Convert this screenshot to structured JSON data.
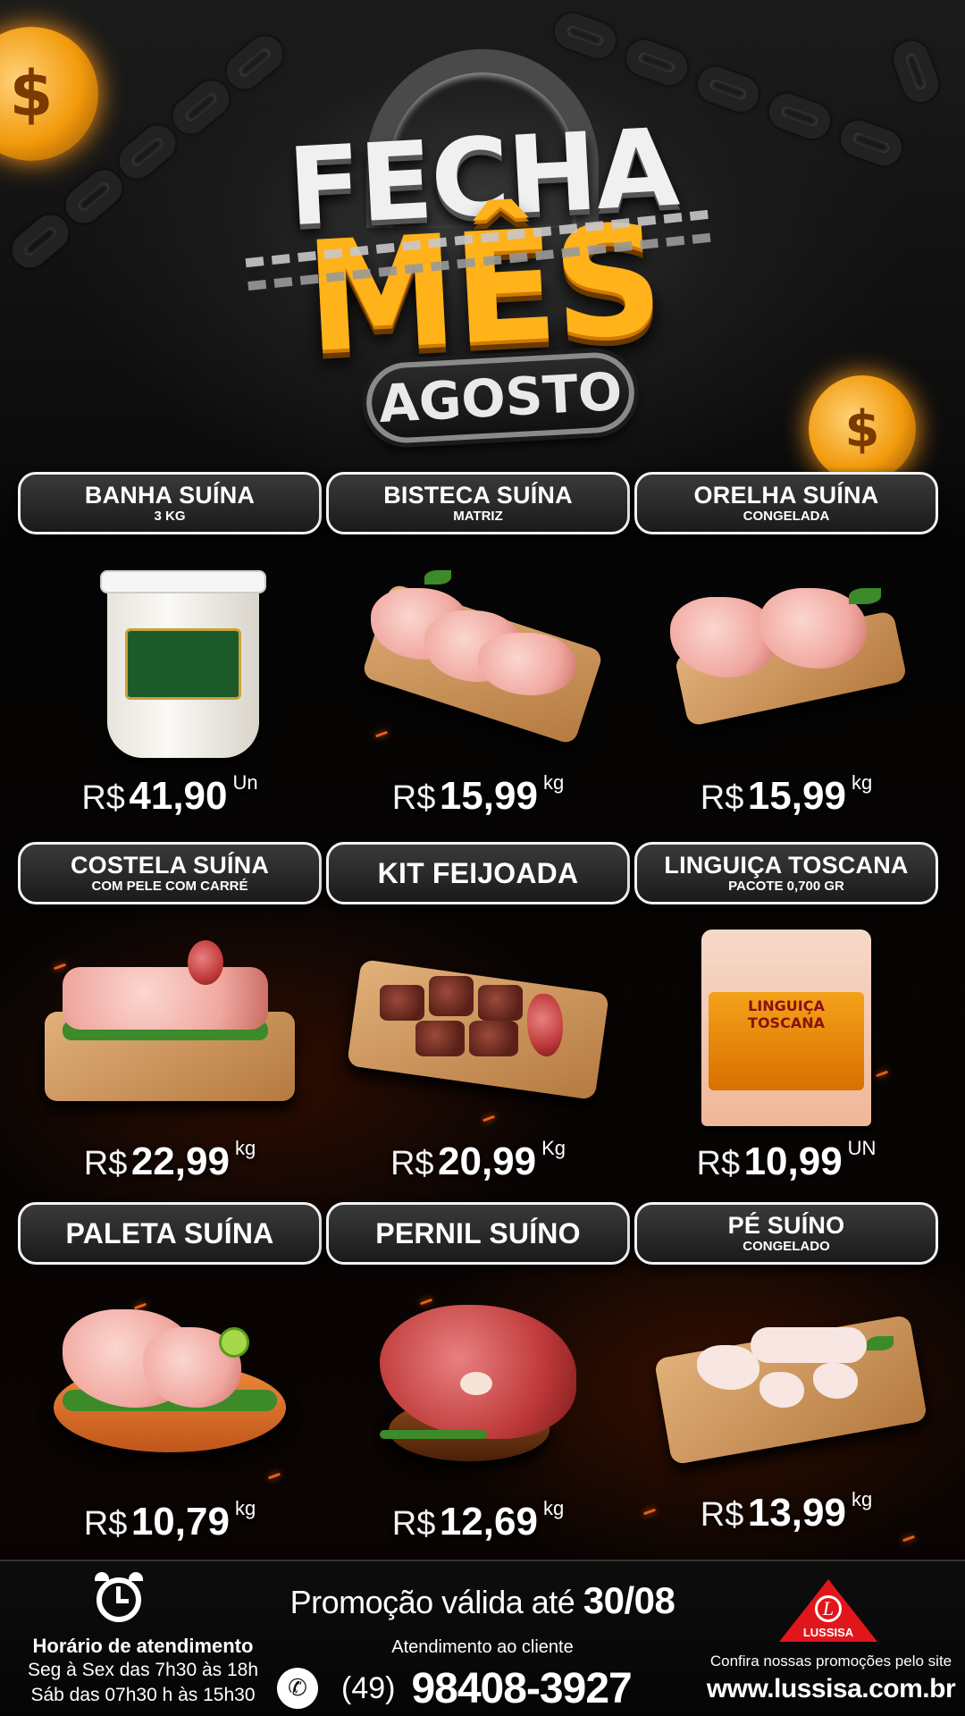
{
  "header": {
    "title_top": "FECHA",
    "title_main": "MÊS",
    "month": "AGOSTO",
    "coin_symbol": "$"
  },
  "products": [
    {
      "name": "BANHA SUÍNA",
      "subtitle": "3 KG",
      "currency": "R$",
      "price": "41,90",
      "unit": "Un",
      "icon": "lard-bucket-icon"
    },
    {
      "name": "BISTECA SUÍNA",
      "subtitle": "MATRIZ",
      "currency": "R$",
      "price": "15,99",
      "unit": "kg",
      "icon": "pork-chop-icon"
    },
    {
      "name": "ORELHA SUÍNA",
      "subtitle": "CONGELADA",
      "currency": "R$",
      "price": "15,99",
      "unit": "kg",
      "icon": "pork-ear-icon"
    },
    {
      "name": "COSTELA SUÍNA",
      "subtitle": "COM PELE COM CARRÉ",
      "currency": "R$",
      "price": "22,99",
      "unit": "kg",
      "icon": "pork-ribs-icon"
    },
    {
      "name": "KIT FEIJOADA",
      "subtitle": "",
      "currency": "R$",
      "price": "20,99",
      "unit": "Kg",
      "icon": "feijoada-kit-icon"
    },
    {
      "name": "LINGUIÇA TOSCANA",
      "subtitle": "PACOTE 0,700 GR",
      "currency": "R$",
      "price": "10,99",
      "unit": "UN",
      "icon": "sausage-pack-icon",
      "pack_label": "LINGUIÇA TOSCANA"
    },
    {
      "name": "PALETA SUÍNA",
      "subtitle": "",
      "currency": "R$",
      "price": "10,79",
      "unit": "kg",
      "icon": "pork-shoulder-icon"
    },
    {
      "name": "PERNIL SUÍNO",
      "subtitle": "",
      "currency": "R$",
      "price": "12,69",
      "unit": "kg",
      "icon": "pork-leg-icon"
    },
    {
      "name": "PÉ SUÍNO",
      "subtitle": "CONGELADO",
      "currency": "R$",
      "price": "13,99",
      "unit": "kg",
      "icon": "pork-feet-icon"
    }
  ],
  "footer": {
    "hours_title": "Horário de atendimento",
    "hours_weekdays": "Seg à Sex das 7h30 às 18h",
    "hours_saturday": "Sáb das 07h30 h às 15h30",
    "promo_prefix": "Promoção válida até",
    "promo_date": "30/08",
    "service_label": "Atendimento ao cliente",
    "phone_ddd": "(49)",
    "phone_number": "98408-3927",
    "brand_initial": "L",
    "brand_name": "LUSSISA",
    "site_cta": "Confira nossas promoções pelo site",
    "site_url": "www.lussisa.com.br"
  },
  "colors": {
    "accent_gold": "#ffb21a",
    "brand_red": "#e1161b",
    "background": "#050505"
  }
}
